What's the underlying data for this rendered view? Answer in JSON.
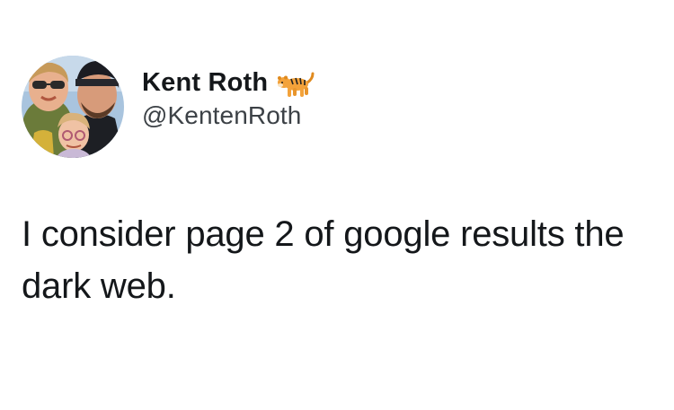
{
  "tweet": {
    "author": {
      "display_name": "Kent Roth",
      "handle": "@KentenRoth",
      "name_emoji": "tiger-emoji"
    },
    "text": "I consider page 2 of google results the dark web."
  },
  "colors": {
    "background": "#ffffff",
    "text": "#14171a",
    "handle": "#3c4146"
  }
}
